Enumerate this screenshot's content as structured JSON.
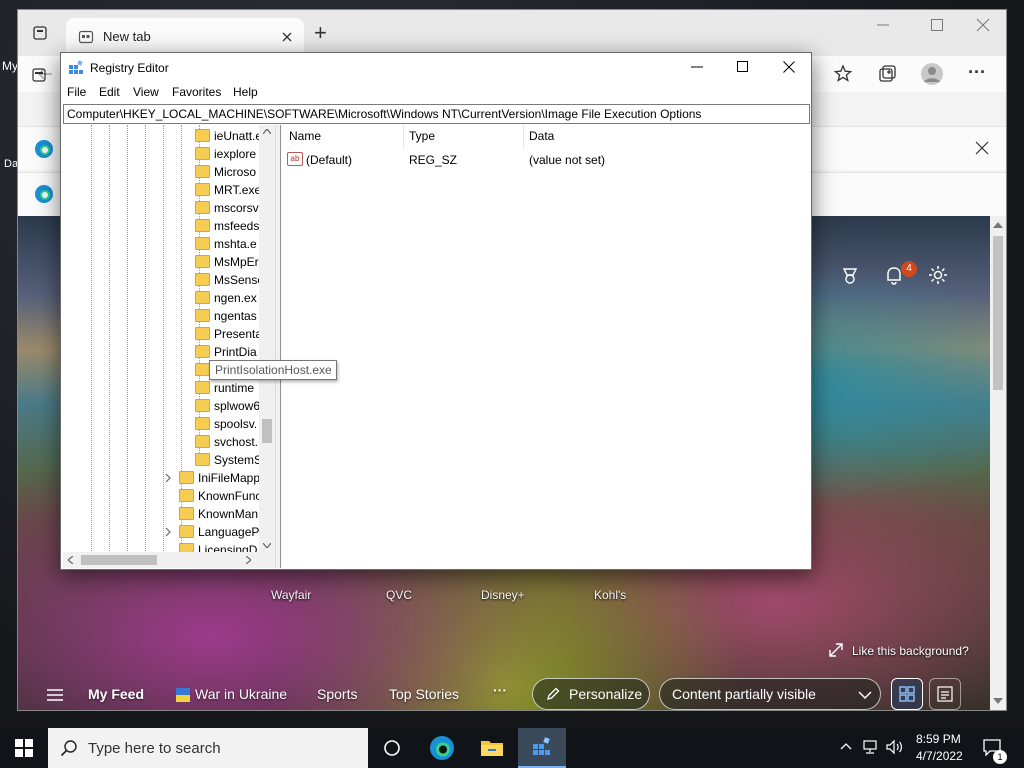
{
  "desktop": {
    "left_label": "My",
    "left_label2": "Da"
  },
  "browser": {
    "tab_title": "New tab",
    "new_tab_symbol": "+",
    "menu_dots": "···",
    "site_labels": [
      "Wayfair",
      "QVC",
      "Disney+",
      "Kohl's"
    ],
    "background_prompt": "Like this background?",
    "notification_count": "4",
    "feed_tabs": [
      "My Feed",
      "War in Ukraine",
      "Sports",
      "Top Stories"
    ],
    "more": "···",
    "personalize": "Personalize",
    "content_visibility": "Content partially visible"
  },
  "regedit": {
    "title": "Registry Editor",
    "menu": [
      "File",
      "Edit",
      "View",
      "Favorites",
      "Help"
    ],
    "address": "Computer\\HKEY_LOCAL_MACHINE\\SOFTWARE\\Microsoft\\Windows NT\\CurrentVersion\\Image File Execution Options",
    "tree_items": [
      "ieUnatt.e",
      "iexplore",
      "Microso",
      "MRT.exe",
      "mscorsv",
      "msfeeds",
      "mshta.e",
      "MsMpEr",
      "MsSense",
      "ngen.ex",
      "ngentas",
      "Presenta",
      "PrintDia",
      "",
      "runtime",
      "splwow6",
      "spoolsv.",
      "svchost.",
      "SystemS"
    ],
    "tree_items_parent": [
      "IniFileMapp",
      "KnownFunc",
      "KnownMan",
      "LanguageP",
      "LicensingD"
    ],
    "tooltip": "PrintIsolationHost.exe",
    "columns": [
      "Name",
      "Type",
      "Data"
    ],
    "rows": [
      {
        "name": "(Default)",
        "type": "REG_SZ",
        "data": "(value not set)",
        "icon_text": "ab"
      }
    ]
  },
  "taskbar": {
    "search_placeholder": "Type here to search",
    "time": "8:59 PM",
    "date": "4/7/2022",
    "notification_badge": "1"
  },
  "icons": [
    "windows-start-icon",
    "search-icon",
    "task-view-icon",
    "edge-icon",
    "file-explorer-icon",
    "regedit-icon",
    "chevron-up-icon",
    "network-icon",
    "volume-icon",
    "action-center-icon"
  ]
}
